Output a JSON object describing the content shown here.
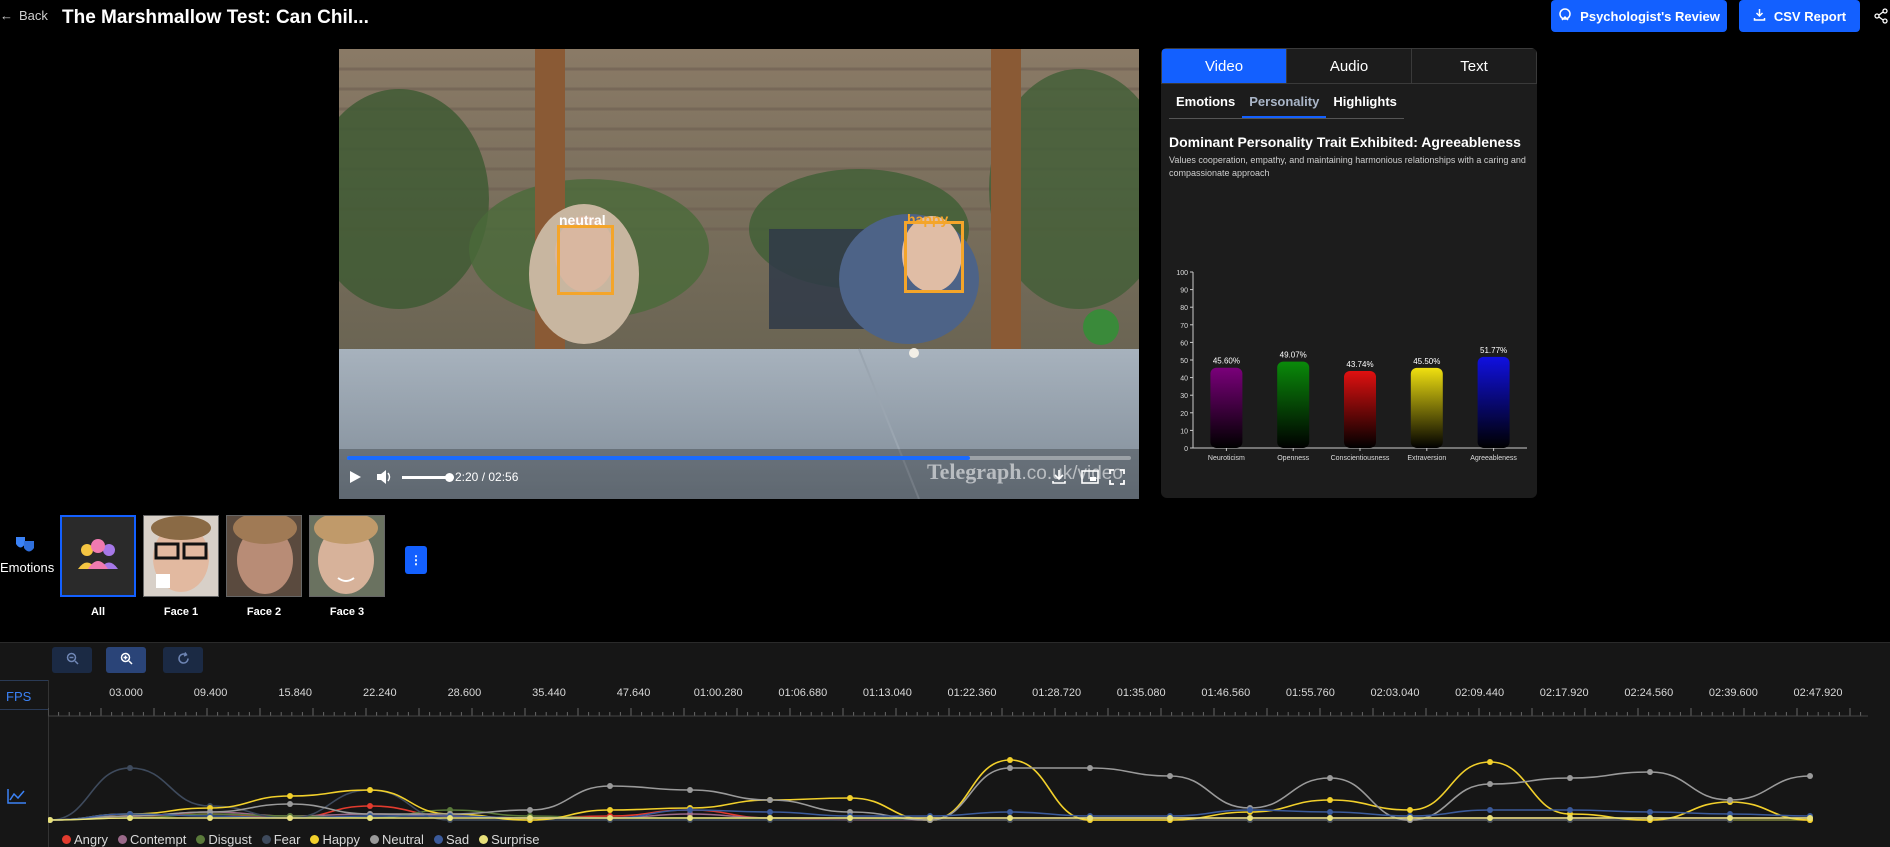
{
  "header": {
    "back_label": "Back",
    "title": "The Marshmallow Test: Can Chil...",
    "psych_button": "Psychologist's Review",
    "csv_button": "CSV Report"
  },
  "video": {
    "time": "2:20 / 02:56",
    "progress_fraction": 0.795,
    "volume_fraction": 1.0,
    "watermark_main": "Telegraph",
    "watermark_suffix": ".co.uk/video",
    "faces": [
      {
        "label": "neutral",
        "color": "#ff3b3b"
      },
      {
        "label": "happy",
        "color": "#f4a52a"
      }
    ]
  },
  "panel": {
    "tabs": [
      "Video",
      "Audio",
      "Text"
    ],
    "active_tab": "Video",
    "subtabs": [
      "Emotions",
      "Personality",
      "Highlights"
    ],
    "active_subtab": "Personality",
    "heading": "Dominant Personality Trait Exhibited: Agreeableness",
    "description": "Values cooperation, empathy, and maintaining harmonious relationships with a caring and compassionate approach"
  },
  "faces_row": {
    "side_label": "Emotions",
    "items": [
      {
        "label": "All"
      },
      {
        "label": "Face 1"
      },
      {
        "label": "Face 2"
      },
      {
        "label": "Face 3"
      }
    ],
    "more_label": "⋮"
  },
  "timeline": {
    "fps_label": "FPS",
    "ticks": [
      "03.000",
      "09.400",
      "15.840",
      "22.240",
      "28.600",
      "35.440",
      "47.640",
      "01:00.280",
      "01:06.680",
      "01:13.040",
      "01:22.360",
      "01:28.720",
      "01:35.080",
      "01:46.560",
      "01:55.760",
      "02:03.040",
      "02:09.440",
      "02:17.920",
      "02:24.560",
      "02:39.600",
      "02:47.920"
    ],
    "legend": [
      {
        "name": "Angry",
        "color": "#e23b2e"
      },
      {
        "name": "Contempt",
        "color": "#9b6a8a"
      },
      {
        "name": "Disgust",
        "color": "#5a7a3a"
      },
      {
        "name": "Fear",
        "color": "#3e4a5c"
      },
      {
        "name": "Happy",
        "color": "#f2d02b"
      },
      {
        "name": "Neutral",
        "color": "#9a9a9a"
      },
      {
        "name": "Sad",
        "color": "#3b5a9a"
      },
      {
        "name": "Surprise",
        "color": "#e8e07a"
      }
    ]
  },
  "chart_data": {
    "type": "bar",
    "categories": [
      "Neuroticism",
      "Openness",
      "Conscientiousness",
      "Extraversion",
      "Agreeableness"
    ],
    "values": [
      45.6,
      49.07,
      43.74,
      45.5,
      51.77
    ],
    "value_labels": [
      "45.60%",
      "49.07%",
      "43.74%",
      "45.50%",
      "51.77%"
    ],
    "colors": [
      "#7a007a",
      "#0a8a0a",
      "#e01010",
      "#f0e010",
      "#1010e0"
    ],
    "ylim": [
      0,
      100
    ],
    "yticks": [
      "0",
      "10",
      "20",
      "30",
      "40",
      "50",
      "60",
      "70",
      "80",
      "90",
      "100"
    ],
    "grid": false
  }
}
